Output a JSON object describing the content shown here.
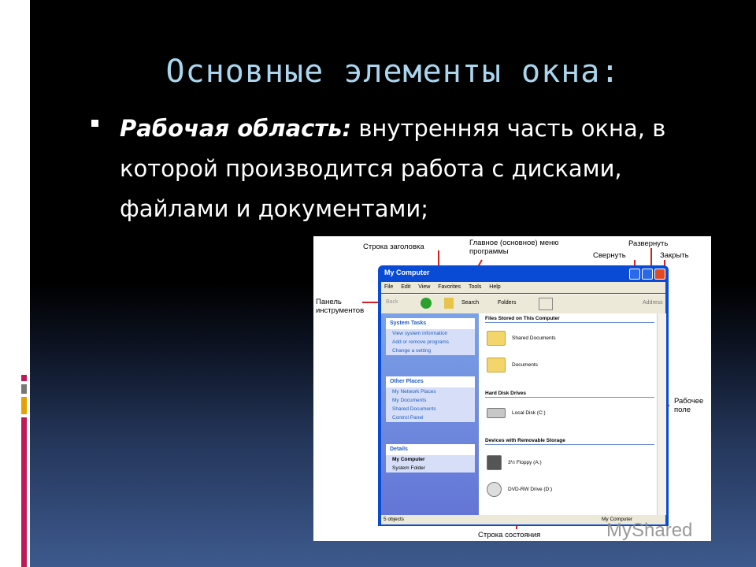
{
  "slide": {
    "title": "Основные элементы окна:",
    "bullet_term": "Рабочая область:",
    "bullet_text": " внутренняя часть окна, в которой производится работа с дисками, файлами и документами;"
  },
  "figure": {
    "annotations": {
      "title_bar": "Строка заголовка",
      "main_menu": "Главное (основное) меню программы",
      "maximize": "Развернуть",
      "minimize": "Свернуть",
      "close": "Закрыть",
      "toolbar": "Панель инструментов",
      "work_area": "Рабочее поле",
      "status_bar": "Строка состояния"
    },
    "window": {
      "title": "My Computer",
      "menu": [
        "File",
        "Edit",
        "View",
        "Favorites",
        "Tools",
        "Help"
      ],
      "toolbar": {
        "back": "Back",
        "search": "Search",
        "folders": "Folders",
        "address": "Address"
      },
      "panels": {
        "system_tasks": {
          "title": "System Tasks",
          "items": [
            "View system information",
            "Add or remove programs",
            "Change a setting"
          ]
        },
        "other_places": {
          "title": "Other Places",
          "items": [
            "My Network Places",
            "My Documents",
            "Shared Documents",
            "Control Panel"
          ]
        },
        "details": {
          "title": "Details",
          "name": "My Computer",
          "sub": "System Folder"
        }
      },
      "content": {
        "group_files": "Files Stored on This Computer",
        "shared_docs": "Shared Documents",
        "documents": "Documents",
        "group_hdd": "Hard Disk Drives",
        "local_disk": "Local Disk (C:)",
        "group_removable": "Devices with Removable Storage",
        "floppy": "3½ Floppy (A:)",
        "dvd": "DVD-RW Drive (D:)"
      },
      "status": {
        "left": "5 objects",
        "right": "My Computer"
      }
    }
  },
  "watermark": "MyShared",
  "colors": {
    "title": "#a9d6ee",
    "arrow": "#d32222",
    "xp_blue": "#0a4bd6"
  }
}
